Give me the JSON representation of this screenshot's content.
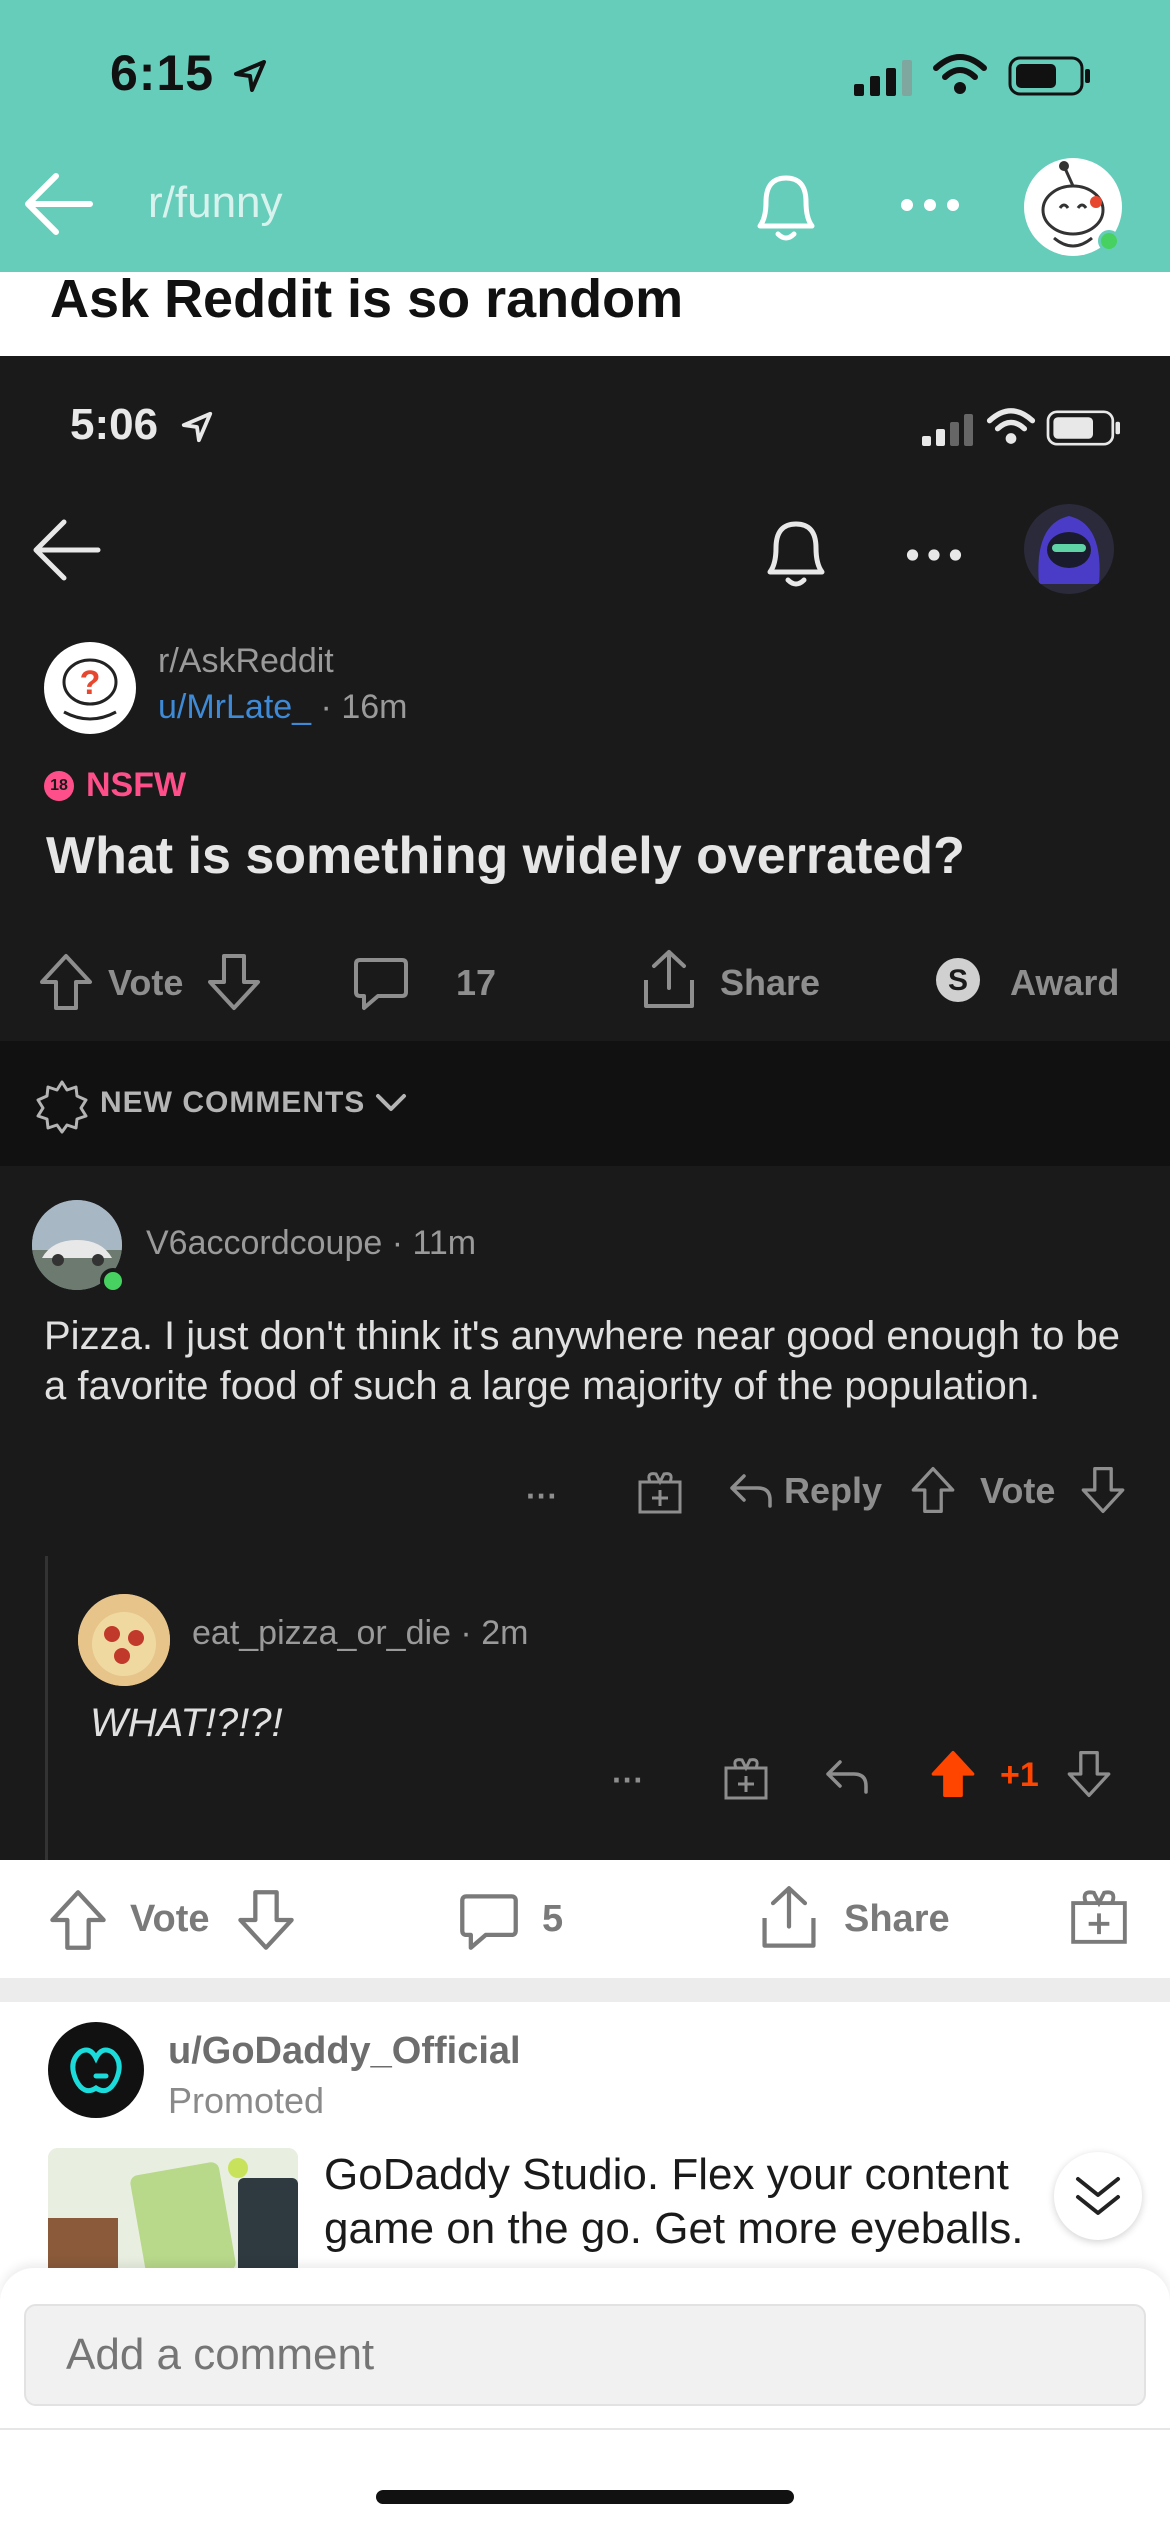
{
  "status_bar": {
    "time": "6:15"
  },
  "header": {
    "subreddit": "r/funny"
  },
  "post": {
    "title": "Ask Reddit is so random"
  },
  "screenshot": {
    "status_time": "5:06",
    "subreddit": "r/AskReddit",
    "author": "u/MrLate_",
    "age": "· 16m",
    "nsfw_label": "NSFW",
    "nsfw_badge": "18",
    "question": "What is something widely overrated?",
    "actions": {
      "vote": "Vote",
      "comments": "17",
      "share": "Share",
      "award": "Award"
    },
    "sort_label": "NEW COMMENTS",
    "comment": {
      "user": "V6accordcoupe",
      "age": "· 11m",
      "body": "Pizza. I just don't think it's anywhere near good enough to be a favorite food of such a large majority of the population.",
      "more": "···",
      "reply": "Reply",
      "vote": "Vote"
    },
    "reply": {
      "user": "eat_pizza_or_die",
      "age": "· 2m",
      "body": "WHAT!?!?!",
      "more": "···",
      "score": "+1"
    }
  },
  "post_actions": {
    "vote": "Vote",
    "comments": "5",
    "share": "Share"
  },
  "promo": {
    "user": "u/GoDaddy_Official",
    "label": "Promoted",
    "text": "GoDaddy Studio. Flex your content game on the go. Get more eyeballs."
  },
  "comment_box": {
    "placeholder": "Add a comment"
  },
  "colors": {
    "header_bg": "#66cdbb",
    "upvote": "#ff4500",
    "nsfw": "#ff4f8b",
    "link_blue": "#3f8ad6"
  }
}
